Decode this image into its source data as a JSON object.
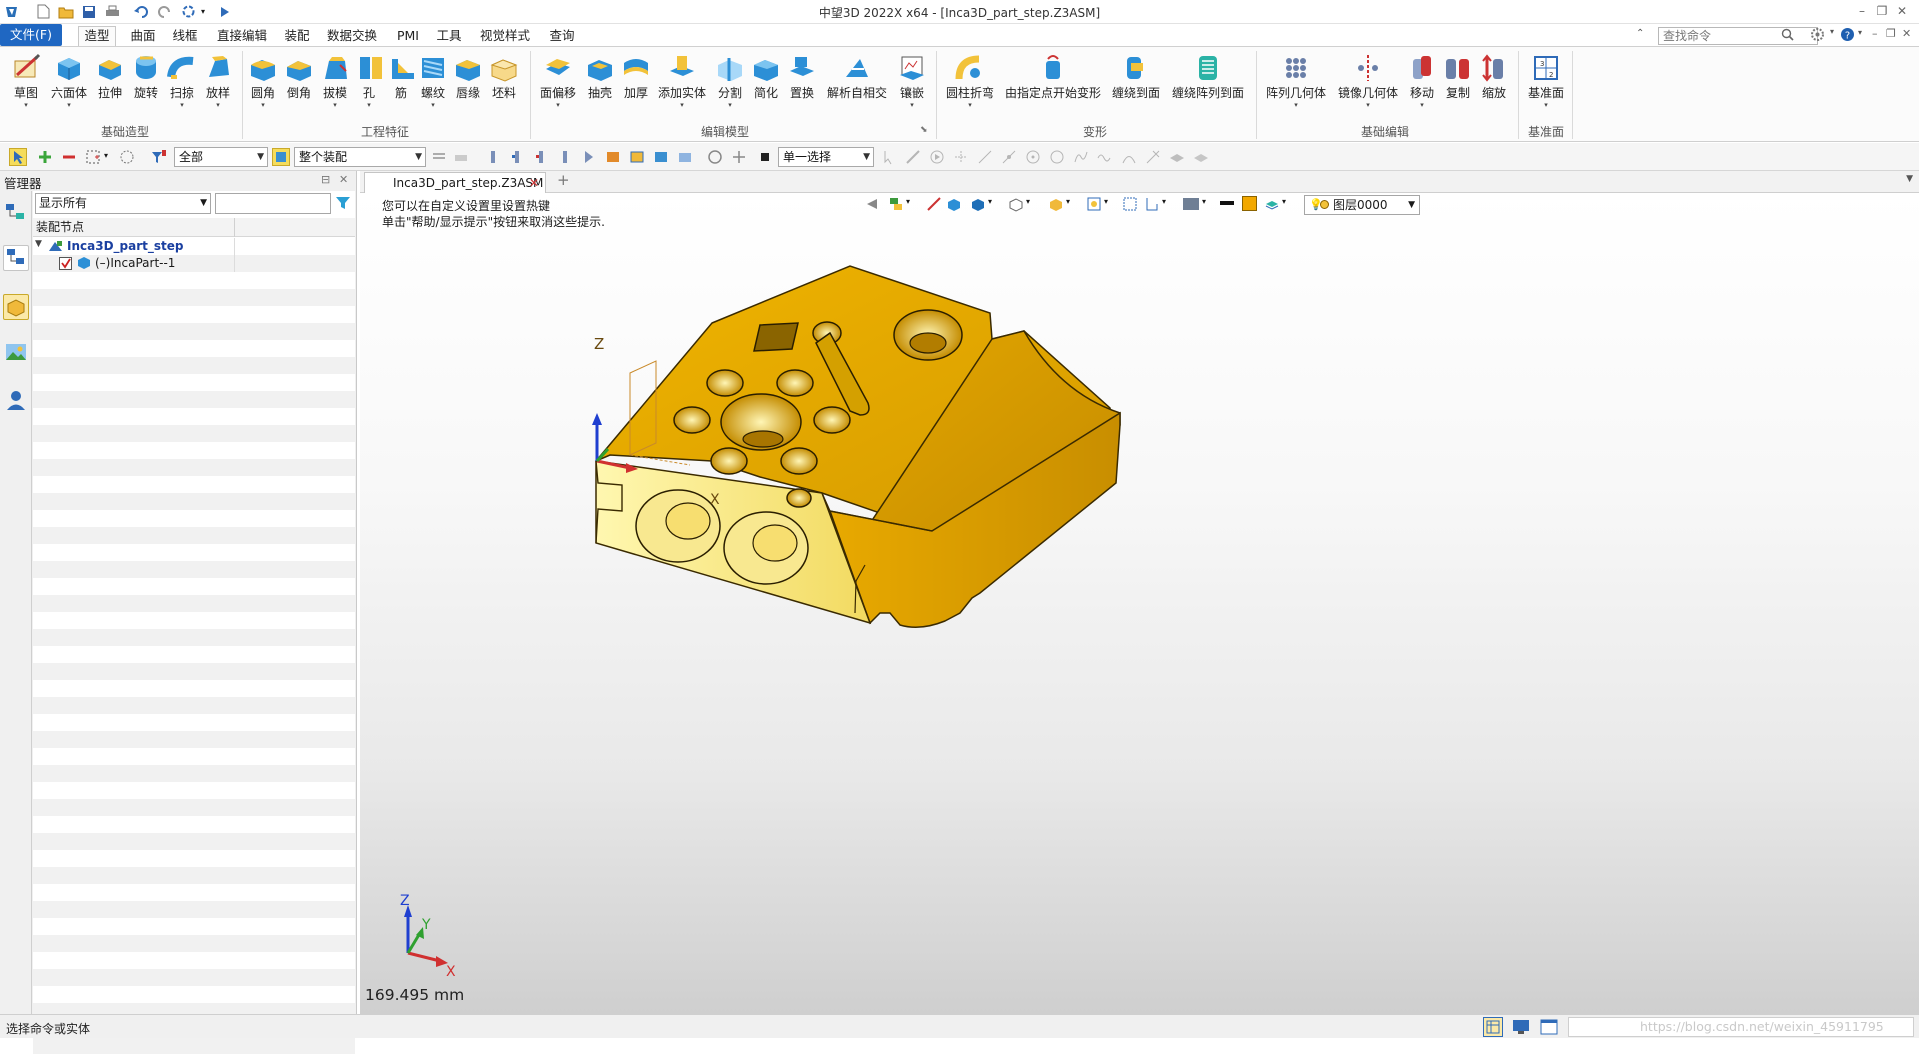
{
  "titlebar": {
    "title": "中望3D 2022X x64 - [Inca3D_part_step.Z3ASM]",
    "minimize": "–",
    "restore": "❐",
    "close": "✕"
  },
  "menubar": {
    "file": "文件(F)",
    "tabs": [
      "造型",
      "曲面",
      "线框",
      "直接编辑",
      "装配",
      "数据交换",
      "PMI",
      "工具",
      "视觉样式",
      "查询"
    ],
    "search_placeholder": "查找命令"
  },
  "ribbon": {
    "groups": [
      {
        "label": "基础造型",
        "buttons": [
          "草图",
          "六面体",
          "拉伸",
          "旋转",
          "扫掠",
          "放样"
        ]
      },
      {
        "label": "工程特征",
        "buttons": [
          "圆角",
          "倒角",
          "拔模",
          "孔",
          "筋",
          "螺纹",
          "唇缘",
          "坯料"
        ]
      },
      {
        "label": "编辑模型",
        "buttons": [
          "面偏移",
          "抽壳",
          "加厚",
          "添加实体",
          "分割",
          "简化",
          "置换",
          "解析自相交",
          "镶嵌"
        ]
      },
      {
        "label": "变形",
        "buttons": [
          "圆柱折弯",
          "由指定点开始变形",
          "缠绕到面",
          "缠绕阵列到面"
        ]
      },
      {
        "label": "基础编辑",
        "buttons": [
          "阵列几何体",
          "镜像几何体",
          "移动",
          "复制",
          "缩放"
        ]
      },
      {
        "label": "基准面",
        "buttons": [
          "基准面"
        ]
      }
    ]
  },
  "toolbar2": {
    "filter_all": "全部",
    "assembly_scope": "整个装配",
    "select_mode": "单一选择"
  },
  "manager": {
    "title": "管理器",
    "show_filter": "显示所有",
    "column_header": "装配节点",
    "tree": [
      {
        "label": "Inca3D_part_step",
        "level": 0
      },
      {
        "label": "(–)IncaPart--1",
        "level": 1
      }
    ]
  },
  "document": {
    "tab": "Inca3D_part_step.Z3ASM",
    "hint_line1": "您可以在自定义设置里设置热键",
    "hint_line2": "单击\"帮助/显示提示\"按钮来取消这些提示.",
    "layer": "图层0000",
    "measurement": "169.495 mm",
    "part_color": "#e6a800",
    "triad": {
      "x": "X",
      "y": "Y",
      "z": "Z"
    }
  },
  "status": {
    "text": "选择命令或实体",
    "watermark": "https://blog.csdn.net/weixin_45911795"
  }
}
